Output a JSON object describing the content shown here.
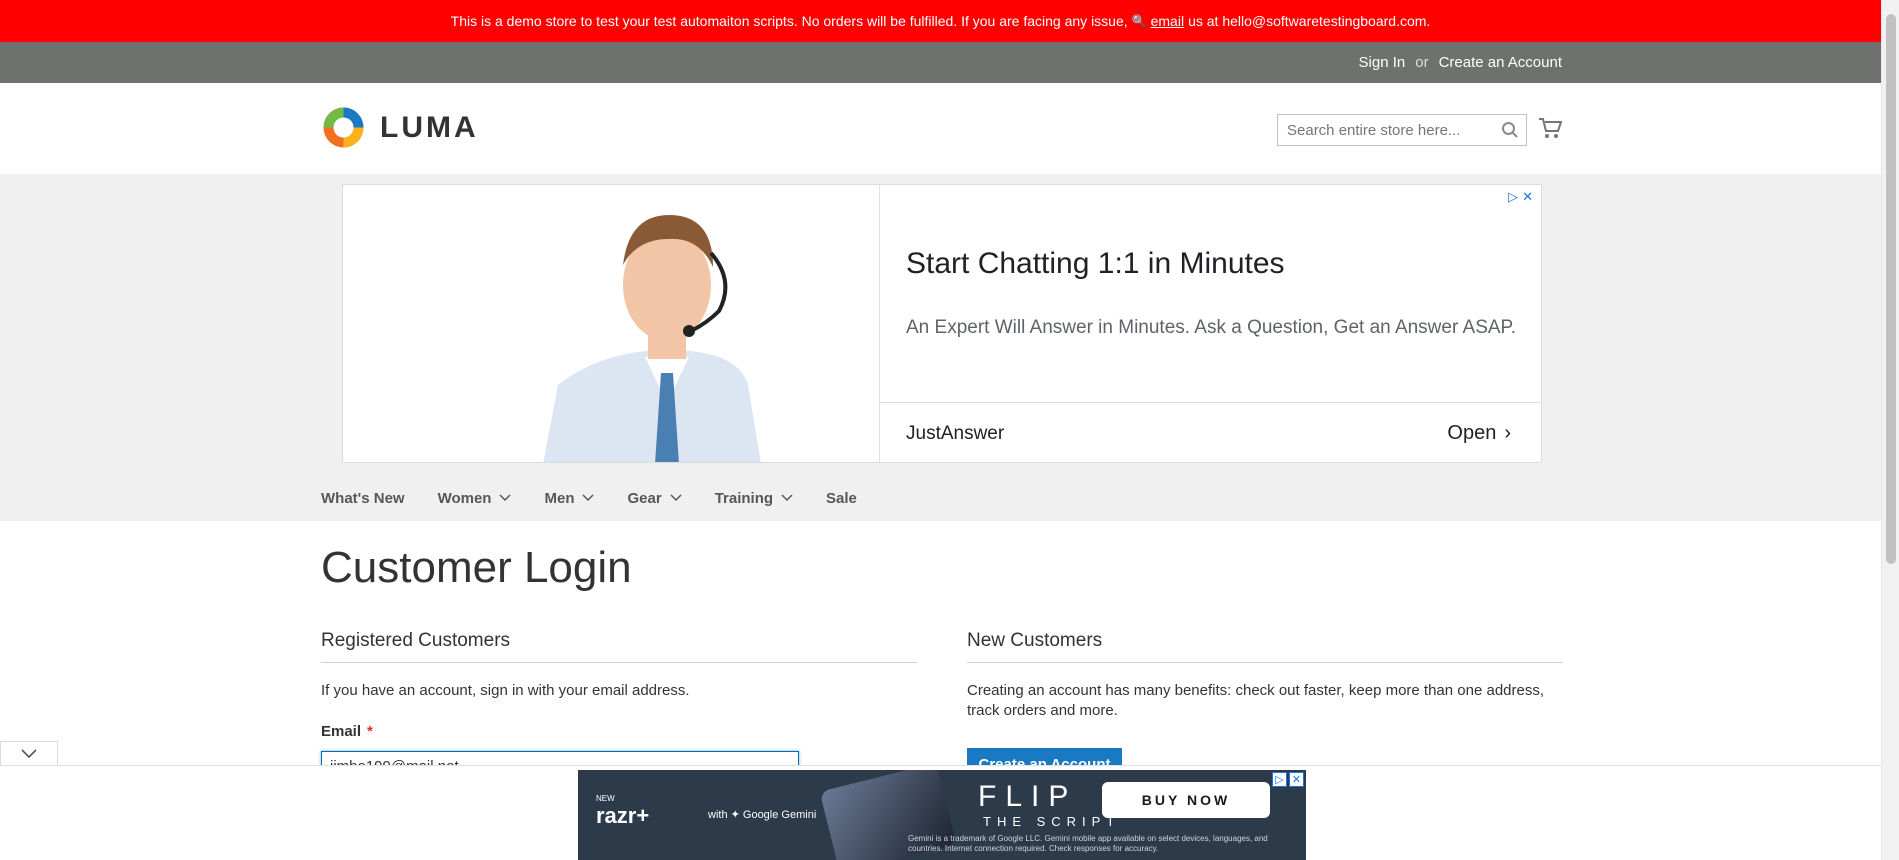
{
  "demo_notice": {
    "text_before": "This is a demo store to test your test automaiton scripts. No orders will be fulfilled. If you are facing any issue,",
    "link_text": "email",
    "text_after": "us at hello@softwaretestingboard.com."
  },
  "panel": {
    "sign_in": "Sign In",
    "or": "or",
    "create_account": "Create an Account"
  },
  "header": {
    "logo_text": "LUMA",
    "search_placeholder": "Search entire store here..."
  },
  "ad": {
    "headline": "Start Chatting 1:1 in Minutes",
    "subtext": "An Expert Will Answer in Minutes. Ask a Question, Get an Answer ASAP.",
    "brand": "JustAnswer",
    "cta": "Open"
  },
  "nav": {
    "items": [
      {
        "label": "What's New",
        "has_dropdown": false
      },
      {
        "label": "Women",
        "has_dropdown": true
      },
      {
        "label": "Men",
        "has_dropdown": true
      },
      {
        "label": "Gear",
        "has_dropdown": true
      },
      {
        "label": "Training",
        "has_dropdown": true
      },
      {
        "label": "Sale",
        "has_dropdown": false
      }
    ]
  },
  "main": {
    "title": "Customer Login",
    "registered": {
      "heading": "Registered Customers",
      "description": "If you have an account, sign in with your email address.",
      "email_label": "Email",
      "required_mark": "*",
      "email_value": "jimbo199@mail.net"
    },
    "new_customers": {
      "heading": "New Customers",
      "description": "Creating an account has many benefits: check out faster, keep more than one address, track orders and more.",
      "button": "Create an Account"
    }
  },
  "bottom_banner": {
    "new": "NEW",
    "brand": "razr+",
    "partner": "with ✦ Google Gemini",
    "title": "FLIP",
    "subtitle": "THE SCRIPT",
    "cta": "BUY NOW",
    "fine_print": "Gemini is a trademark of Google LLC. Gemini mobile app available on select devices, languages, and countries. Internet connection required. Check responses for accuracy."
  },
  "colors": {
    "demo_bar": "#ff0000",
    "panel": "#6e716e",
    "primary_button": "#1979c3",
    "required": "#e02b27"
  }
}
